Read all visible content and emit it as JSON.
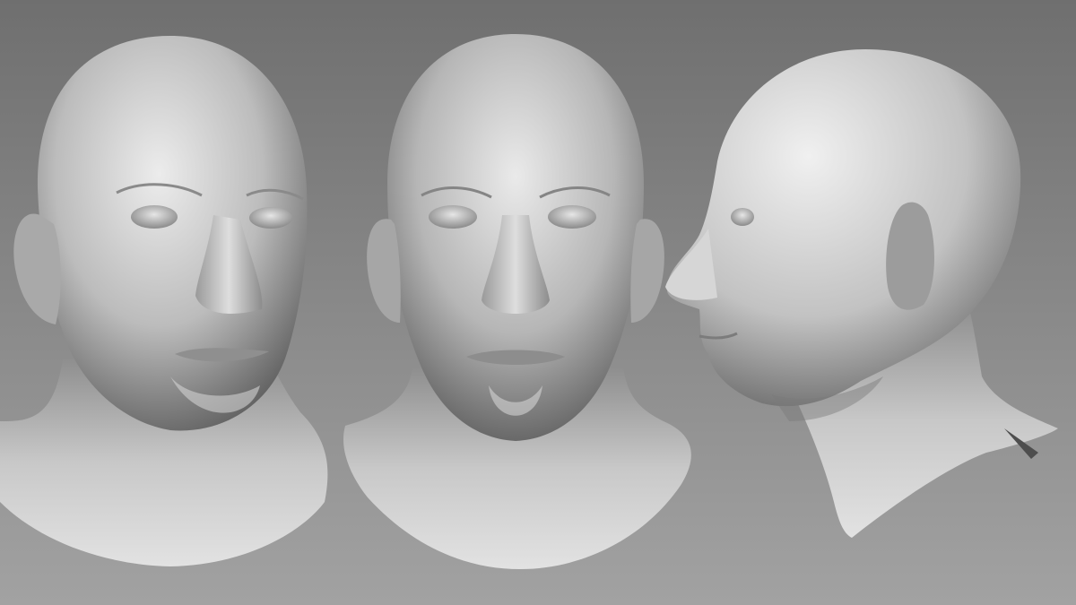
{
  "scene": {
    "background_top": "#6f6f6f",
    "background_bottom": "#a2a2a2",
    "clay_light": "#e9e9e9",
    "clay_mid": "#b8b8b8",
    "clay_dark": "#5a5a5a",
    "views": [
      {
        "name": "three-quarter"
      },
      {
        "name": "front"
      },
      {
        "name": "profile"
      }
    ]
  }
}
